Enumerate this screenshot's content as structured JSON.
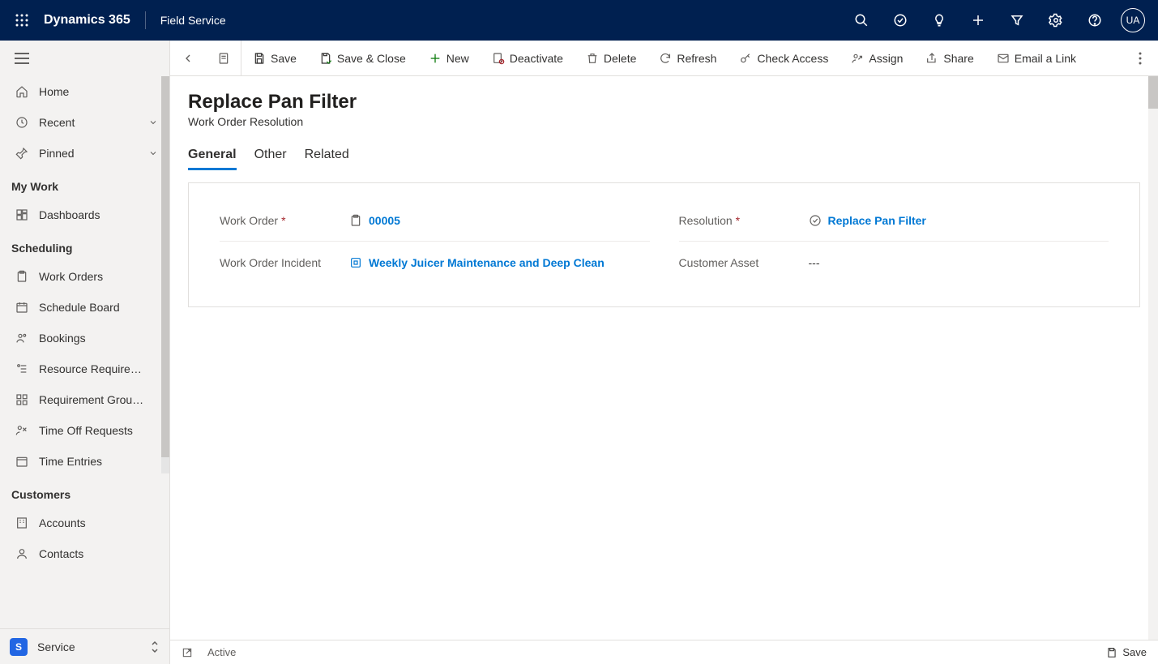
{
  "topbar": {
    "brand": "Dynamics 365",
    "app": "Field Service",
    "avatar": "UA"
  },
  "sidebar": {
    "home": "Home",
    "recent": "Recent",
    "pinned": "Pinned",
    "groups": {
      "mywork": {
        "title": "My Work",
        "dashboards": "Dashboards"
      },
      "scheduling": {
        "title": "Scheduling",
        "workorders": "Work Orders",
        "scheduleboard": "Schedule Board",
        "bookings": "Bookings",
        "resourcereq": "Resource Require…",
        "reqgroups": "Requirement Grou…",
        "timeoff": "Time Off Requests",
        "timeentries": "Time Entries"
      },
      "customers": {
        "title": "Customers",
        "accounts": "Accounts",
        "contacts": "Contacts"
      }
    },
    "area": {
      "badge": "S",
      "label": "Service"
    }
  },
  "commands": {
    "save": "Save",
    "saveclose": "Save & Close",
    "new": "New",
    "deactivate": "Deactivate",
    "delete": "Delete",
    "refresh": "Refresh",
    "checkaccess": "Check Access",
    "assign": "Assign",
    "share": "Share",
    "emaillink": "Email a Link"
  },
  "record": {
    "title": "Replace Pan Filter",
    "subtitle": "Work Order Resolution"
  },
  "tabs": {
    "general": "General",
    "other": "Other",
    "related": "Related"
  },
  "form": {
    "workorder_label": "Work Order",
    "workorder_value": "00005",
    "incident_label": "Work Order Incident",
    "incident_value": "Weekly Juicer Maintenance and Deep Clean",
    "resolution_label": "Resolution",
    "resolution_value": "Replace Pan Filter",
    "asset_label": "Customer Asset",
    "asset_value": "---"
  },
  "statusbar": {
    "status": "Active",
    "save": "Save"
  }
}
